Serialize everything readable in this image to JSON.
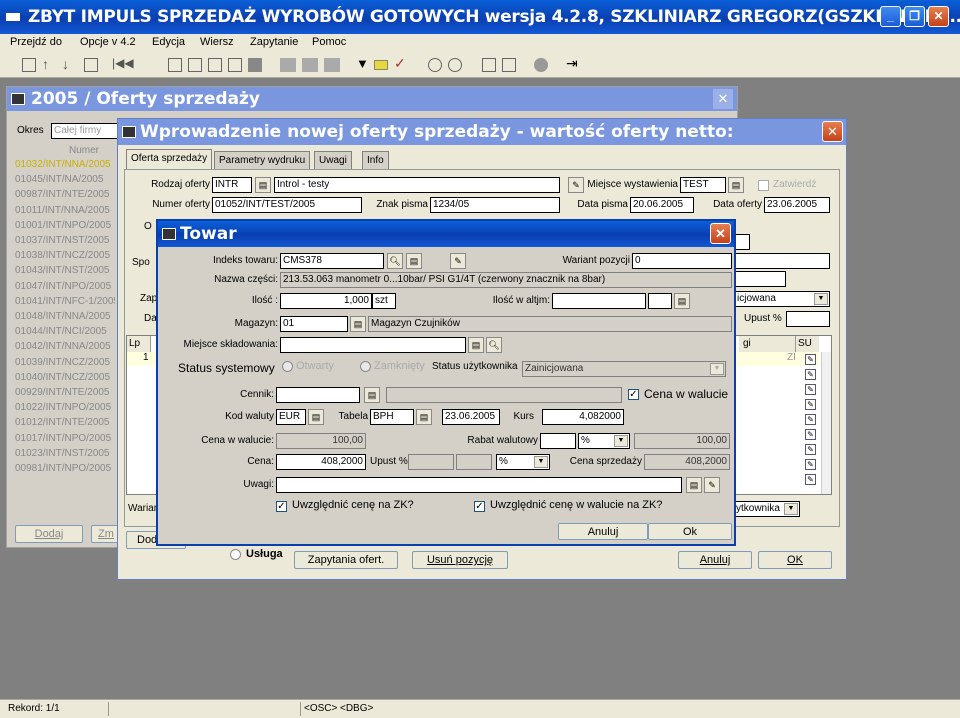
{
  "app": {
    "title": "ZBYT IMPULS SPRZEDAŻ WYROBÓW GOTOWYCH wersja 4.2.8, SZKLINIARZ GREGORZ(GSZKLINIARZ...",
    "menu": [
      "Przejdź do",
      "Opcje v 4.2",
      "Edycja",
      "Wiersz",
      "Zapytanie",
      "Pomoc"
    ],
    "status": {
      "record": "Rekord: 1/1",
      "osc": "<OSC>",
      "dbg": "<DBG>"
    }
  },
  "offers_window": {
    "title": "2005 / Oferty sprzedaży",
    "okres_label": "Okres",
    "okres_placeholder": "Całej firmy",
    "column_header": "Numer",
    "rows": [
      "01032/INT/NNA/2005",
      "01045/INT/NA/2005",
      "00987/INT/NTE/2005",
      "01011/INT/NNA/2005",
      "01001/INT/NPO/2005",
      "01037/INT/NST/2005",
      "01038/INT/NCZ/2005",
      "01043/INT/NST/2005",
      "01047/INT/NPO/2005",
      "01041/INT/NFC-1/2005",
      "01048/INT/NNA/2005",
      "01044/INT/NCI/2005",
      "01042/INT/NNA/2005",
      "01039/INT/NCZ/2005",
      "01040/INT/NCZ/2005",
      "00929/INT/NTE/2005",
      "01022/INT/NPO/2005",
      "01012/INT/NTE/2005",
      "01017/INT/NPO/2005",
      "01023/INT/NST/2005",
      "00981/INT/NPO/2005"
    ],
    "btn_add": "Dodaj",
    "btn_second": "Zm"
  },
  "offer_dialog": {
    "title": "Wprowadzenie nowej oferty sprzedaży - wartość oferty netto:",
    "tabs": [
      "Oferta sprzedaży",
      "Parametry wydruku",
      "Uwagi",
      "Info"
    ],
    "rodzaj_label": "Rodzaj oferty",
    "rodzaj_value": "INTR",
    "rodzaj_desc": "Introl - testy",
    "miejsce_label": "Miejsce wystawienia",
    "miejsce_value": "TEST",
    "zatwierdz_label": "Zatwierdź",
    "numer_label": "Numer oferty",
    "numer_value": "01052/INT/TEST/2005",
    "znak_label": "Znak pisma",
    "znak_value": "1234/05",
    "data_pisma_label": "Data pisma",
    "data_pisma_value": "20.06.2005",
    "data_oferty_label": "Data oferty",
    "data_oferty_value": "23.06.2005",
    "side_labels": {
      "o": "O",
      "spo": "Spo",
      "zap": "Zap",
      "da": "Da"
    },
    "status_combo": "icjowana",
    "upust_label": "Upust %",
    "grid_lp": "Lp",
    "grid_row_lp": "1",
    "grid_col_gi": "gi",
    "grid_col_su": "SU",
    "grid_cell_zi": "ZI",
    "wariant_label": "Warian",
    "status_user_combo": "żytkownika",
    "btn_add": "Dod",
    "radio_usluga": "Usługa",
    "btn_zapytania": "Zapytania ofert.",
    "btn_usun": "Usuń pozycję",
    "btn_anuluj": "Anuluj",
    "btn_ok": "OK"
  },
  "towar_dialog": {
    "title": "Towar",
    "indeks_label": "Indeks towaru:",
    "indeks_value": "CMS378",
    "wariant_label": "Wariant pozycji",
    "wariant_value": "0",
    "nazwa_label": "Nazwa części:",
    "nazwa_value": "213.53.063 manometr 0...10bar/ PSI G1/4T (czerwony znacznik na 8bar)",
    "ilosc_label": "Ilość :",
    "ilosc_value": "1,000",
    "ilosc_unit": "szt",
    "ilosc_altjm_label": "Ilość w altjm:",
    "magazyn_label": "Magazyn:",
    "magazyn_value": "01",
    "magazyn_desc": "Magazyn Czujników",
    "miejsce_label": "Miejsce składowania:",
    "status_sys_label": "Status systemowy",
    "otwarty_label": "Otwarty",
    "zamkniety_label": "Zamknięty",
    "status_user_label": "Status użytkownika",
    "status_user_value": "Zainicjowana",
    "cennik_label": "Cennik:",
    "cena_w_walucie_check": "Cena w walucie",
    "kod_waluty_label": "Kod waluty",
    "kod_waluty_value": "EUR",
    "tabela_label": "Tabela",
    "tabela_value": "BPH",
    "tabela_date": "23.06.2005",
    "kurs_label": "Kurs",
    "kurs_value": "4,082000",
    "cena_waluta_label": "Cena w walucie:",
    "cena_waluta_value": "100,00",
    "rabat_label": "Rabat walutowy",
    "rabat_combo": "%",
    "rabat_total": "100,00",
    "cena_label": "Cena:",
    "cena_value": "408,2000",
    "upust_label": "Upust %",
    "upust_combo": "%",
    "cena_sprzedazy_label": "Cena sprzedaży",
    "cena_sprzedazy_value": "408,2000",
    "uwagi_label": "Uwagi:",
    "zk_check": "Uwzględnić cenę na ZK?",
    "zk_waluta_check": "Uwzględnić cenę w walucie na ZK?",
    "btn_anuluj": "Anuluj",
    "btn_ok": "Ok"
  },
  "colors": {
    "xp_blue": "#0a4fd0",
    "desktop": "#808080",
    "dialog_bg": "#d4d0c8",
    "highlight_row": "#ffffe0"
  }
}
